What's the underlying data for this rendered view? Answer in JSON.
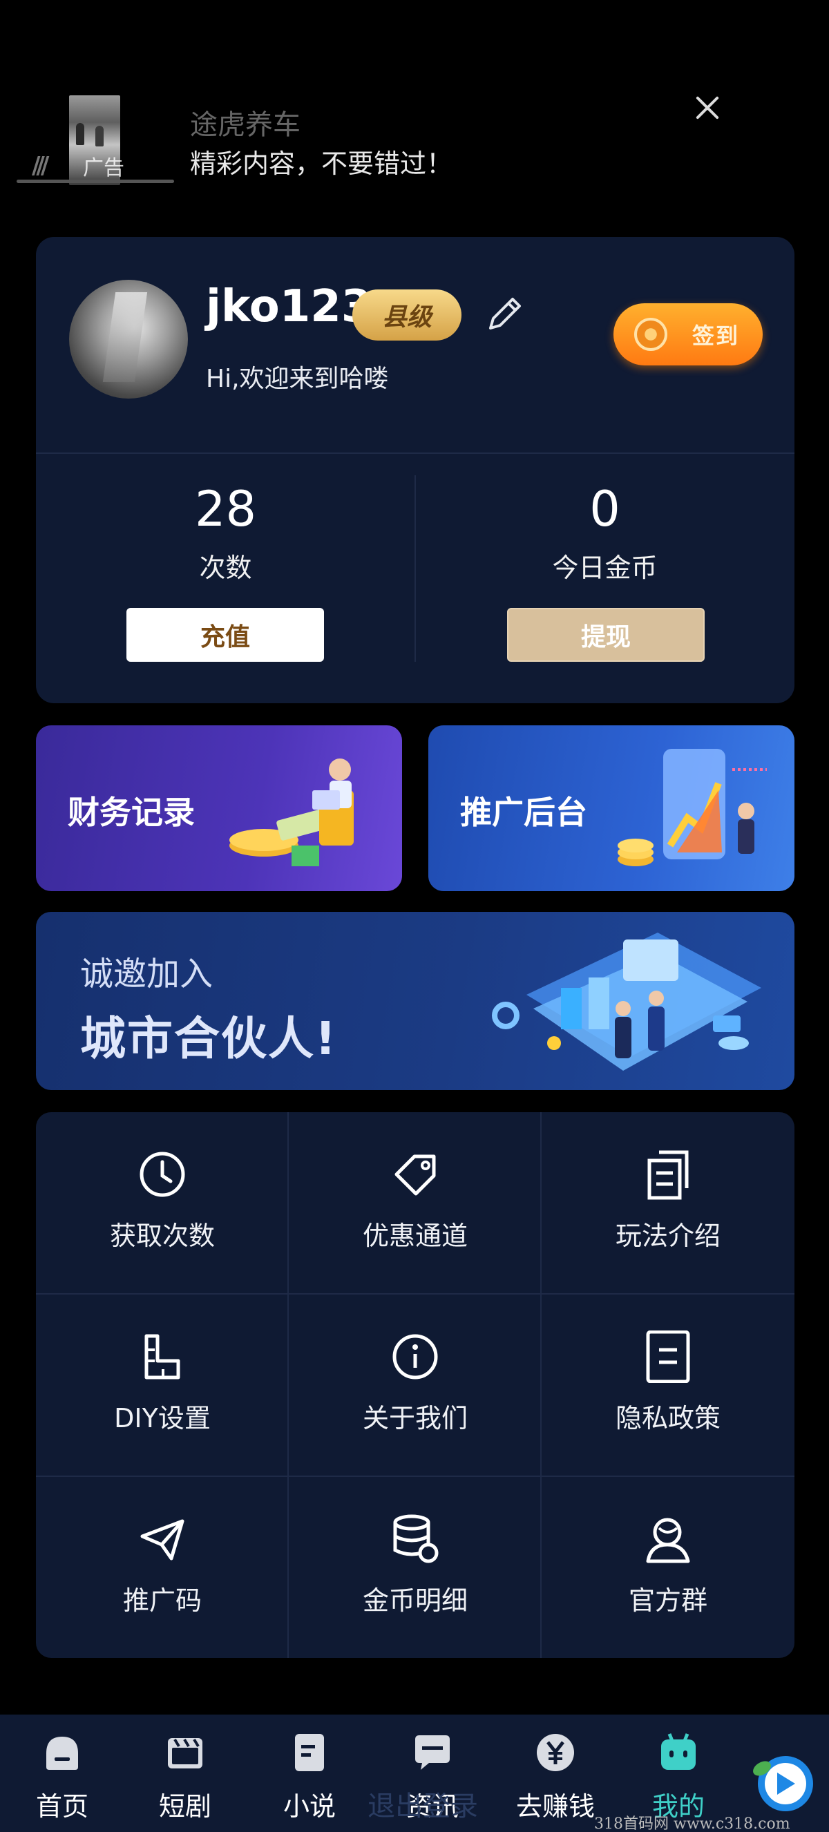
{
  "ad": {
    "tag": "广告",
    "title": "途虎养车",
    "description": "精彩内容，不要错过！"
  },
  "profile": {
    "username": "jko123",
    "level": "县级",
    "welcome": "Hi,欢迎来到哈喽",
    "signin_label": "签到",
    "stats": [
      {
        "value": "28",
        "label": "次数",
        "button": "充值"
      },
      {
        "value": "0",
        "label": "今日金币",
        "button": "提现"
      }
    ]
  },
  "features": {
    "finance_label": "财务记录",
    "promo_label": "推广后台"
  },
  "partner": {
    "subtitle": "诚邀加入",
    "title": "城市合伙人!"
  },
  "menu": [
    {
      "label": "获取次数",
      "icon": "clock-icon"
    },
    {
      "label": "优惠通道",
      "icon": "tag-icon"
    },
    {
      "label": "玩法介绍",
      "icon": "document-copy-icon"
    },
    {
      "label": "DIY设置",
      "icon": "diy-icon"
    },
    {
      "label": "关于我们",
      "icon": "info-icon"
    },
    {
      "label": "隐私政策",
      "icon": "document-icon"
    },
    {
      "label": "推广码",
      "icon": "paper-plane-icon"
    },
    {
      "label": "金币明细",
      "icon": "coins-stack-icon"
    },
    {
      "label": "官方群",
      "icon": "group-icon"
    }
  ],
  "tabs": [
    {
      "label": "首页",
      "icon": "home-icon"
    },
    {
      "label": "短剧",
      "icon": "clapperboard-icon"
    },
    {
      "label": "小说",
      "icon": "book-icon"
    },
    {
      "label": "资讯",
      "icon": "chat-icon"
    },
    {
      "label": "去赚钱",
      "icon": "yen-coin-icon"
    },
    {
      "label": "我的",
      "icon": "robot-icon"
    }
  ],
  "ghost_text": "退出登录",
  "watermark": "318首码网 www.c318.com",
  "colors": {
    "background": "#000000",
    "card": "#0f1a33",
    "accent_orange": "#ff8a1c",
    "active_tab": "#3fd0c8",
    "gold": "#d5a247"
  }
}
